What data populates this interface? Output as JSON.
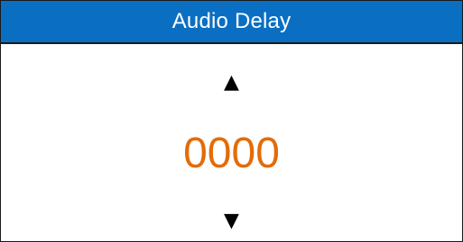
{
  "header": {
    "title": "Audio Delay"
  },
  "stepper": {
    "increment_glyph": "▲",
    "value": "0000",
    "decrement_glyph": "▼",
    "increment_icon": "triangle-up-icon",
    "decrement_icon": "triangle-down-icon"
  },
  "colors": {
    "header_background": "#0a6fc2",
    "header_text": "#ffffff",
    "value_text": "#e36c09",
    "border": "#1a1a1a"
  }
}
